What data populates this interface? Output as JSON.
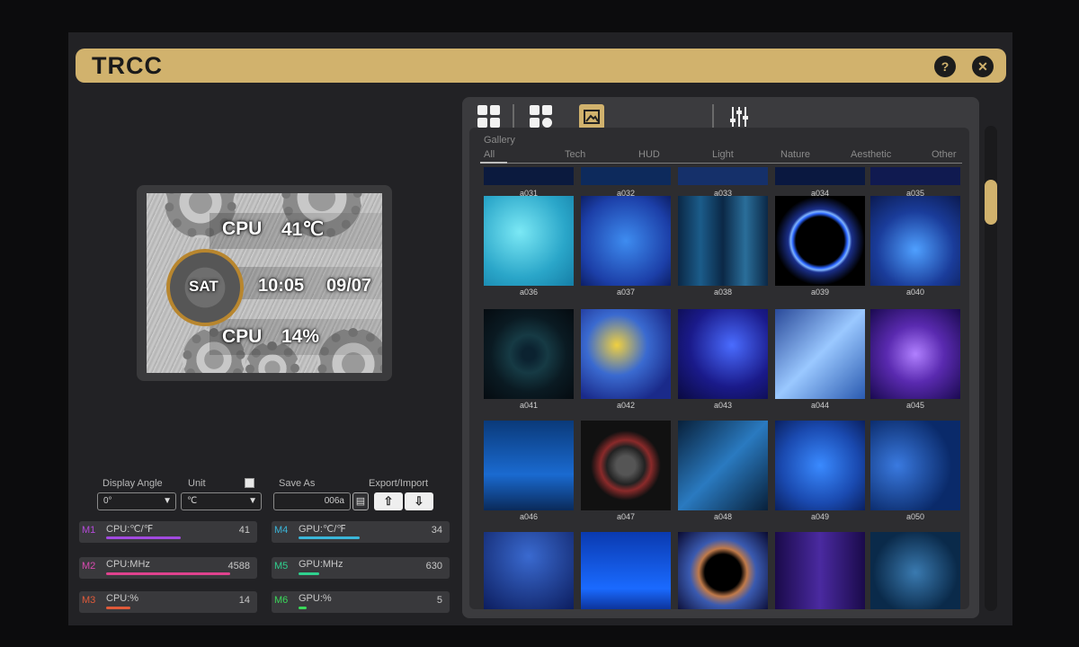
{
  "app": {
    "title": "TRCC",
    "help_icon": "?",
    "close_icon": "✕"
  },
  "preview": {
    "cpu_temp_label": "CPU",
    "cpu_temp_value": "41℃",
    "day": "SAT",
    "time": "10:05",
    "date": "09/07",
    "cpu_usage_label": "CPU",
    "cpu_usage_value": "14%"
  },
  "settings": {
    "display_angle_label": "Display Angle",
    "display_angle_value": "0°",
    "unit_label": "Unit",
    "unit_value": "℃",
    "save_as_label": "Save As",
    "save_as_value": "006a",
    "export_import_label": "Export/Import"
  },
  "monitors": [
    {
      "tag": "M1",
      "name": "CPU:℃/℉",
      "value": "41",
      "fill": 0.55,
      "tag_color": "#b44ad9",
      "bar_color": "#a24ae0"
    },
    {
      "tag": "M2",
      "name": "CPU:MHz",
      "value": "4588",
      "fill": 0.92,
      "tag_color": "#d94ab0",
      "bar_color": "#e0428e"
    },
    {
      "tag": "M3",
      "name": "CPU:%",
      "value": "14",
      "fill": 0.18,
      "tag_color": "#e05a3a",
      "bar_color": "#e05a3a"
    },
    {
      "tag": "M4",
      "name": "GPU:℃/℉",
      "value": "34",
      "fill": 0.45,
      "tag_color": "#3ab6d9",
      "bar_color": "#3ab6d9"
    },
    {
      "tag": "M5",
      "name": "GPU:MHz",
      "value": "630",
      "fill": 0.15,
      "tag_color": "#2fd18e",
      "bar_color": "#2fd18e"
    },
    {
      "tag": "M6",
      "name": "GPU:%",
      "value": "5",
      "fill": 0.06,
      "tag_color": "#3ad95a",
      "bar_color": "#3ad95a"
    }
  ],
  "gallery": {
    "title": "Gallery",
    "categories": [
      "All",
      "Tech",
      "HUD",
      "Light",
      "Nature",
      "Aesthetic",
      "Other"
    ],
    "rows": [
      {
        "items": [
          "a031",
          "a032",
          "a033",
          "a034",
          "a035"
        ]
      },
      {
        "items": [
          "a036",
          "a037",
          "a038",
          "a039",
          "a040"
        ]
      },
      {
        "items": [
          "a041",
          "a042",
          "a043",
          "a044",
          "a045"
        ]
      },
      {
        "items": [
          "a046",
          "a047",
          "a048",
          "a049",
          "a050"
        ]
      },
      {
        "items": [
          "",
          "",
          "",
          "",
          ""
        ]
      }
    ]
  },
  "colors": {
    "accent": "#d1b26d",
    "window_bg": "#222225",
    "panel_bg": "#3b3b3e"
  }
}
